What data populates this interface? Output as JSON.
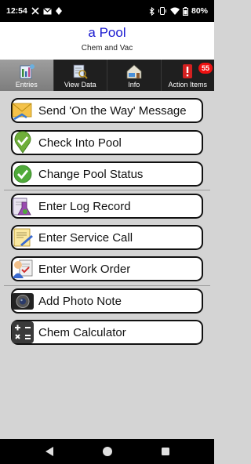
{
  "status_bar": {
    "time": "12:54",
    "battery": "80%",
    "left_icons": [
      "x-icon",
      "mail-icon",
      "diamond-icon"
    ],
    "right_icons": [
      "bluetooth-icon",
      "vibrate-icon",
      "wifi-icon",
      "battery-icon"
    ]
  },
  "header": {
    "title": "a Pool",
    "subtitle": "Chem and Vac",
    "title_color": "#1a1ad0"
  },
  "tabs": [
    {
      "label": "Entries",
      "icon": "entries-icon",
      "active": true
    },
    {
      "label": "View Data",
      "icon": "view-data-icon",
      "active": false
    },
    {
      "label": "Info",
      "icon": "info-icon",
      "active": false
    },
    {
      "label": "Action Items",
      "icon": "action-items-icon",
      "active": false,
      "badge": "55"
    }
  ],
  "actions": [
    {
      "label": "Send 'On the Way' Message",
      "icon": "envelope-icon"
    },
    {
      "label": "Check Into Pool",
      "icon": "map-pin-check-icon"
    },
    {
      "label": "Change Pool Status",
      "icon": "green-check-icon"
    },
    {
      "label": "Enter Log Record",
      "icon": "beaker-icon"
    },
    {
      "label": "Enter Service Call",
      "icon": "service-call-icon"
    },
    {
      "label": "Enter Work Order",
      "icon": "work-order-icon"
    },
    {
      "label": "Add Photo Note",
      "icon": "camera-icon"
    },
    {
      "label": "Chem Calculator",
      "icon": "calculator-icon"
    }
  ],
  "nav_bar": {
    "buttons": [
      "back-icon",
      "home-icon",
      "recents-icon"
    ]
  }
}
